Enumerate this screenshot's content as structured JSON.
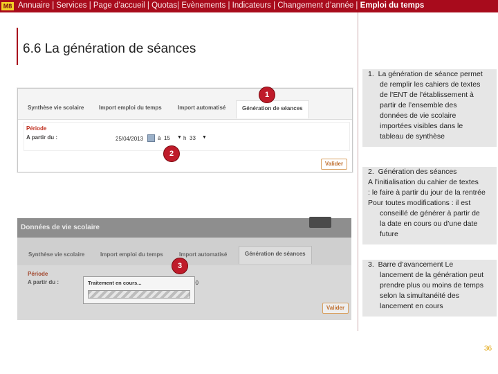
{
  "header": {
    "logo": "M8",
    "nav": "Annuaire |  Services | Page d’accueil | Quotas| Evènements | Indicateurs |  Changement d’année  |",
    "nav_current": " Emploi du temps"
  },
  "section_title": "6.6  La génération de séances",
  "screenshot_top": {
    "tabs": [
      "Synthèse vie scolaire",
      "Import emploi du temps",
      "Import automatisé",
      "Génération de séances"
    ],
    "period_title": "Période",
    "from_label": "A partir du :",
    "date_value": "25/04/2013",
    "hour_prefix": "à",
    "hour_value": "15",
    "minute_prefix": "h",
    "minute_value": "33",
    "validate_label": "Valider"
  },
  "screenshot_bottom": {
    "header_title": "Données de vie scolaire",
    "tabs": [
      "Synthèse vie scolaire",
      "Import emploi du temps",
      "Import automatisé",
      "Génération de séances"
    ],
    "period_title": "Période",
    "from_label": "A partir du :",
    "progress_title": "Traitement en cours...",
    "minute_value": "00",
    "validate_label": "Valider"
  },
  "badges": [
    "1",
    "2",
    "3"
  ],
  "notes": [
    {
      "number": "1.",
      "lines": [
        "La  génération de séance permet",
        "de remplir les cahiers de textes",
        "de l’ENT de l’établissement à",
        "partir de l’ensemble des",
        "données de vie scolaire",
        "importées visibles dans le",
        "tableau de synthèse"
      ]
    },
    {
      "number": "2.",
      "lines": [
        "Génération des séances",
        "A l’initialisation du cahier de textes",
        ": le faire à partir du jour de la rentrée",
        "Pour toutes modifications : il est",
        "conseillé de générer à partir de",
        "la date en cours ou d’une date",
        "future"
      ]
    },
    {
      "number": "3.",
      "lines": [
        "Barre d’avancement Le",
        "lancement de la génération peut",
        "prendre plus ou moins de temps",
        "selon la simultanéité des",
        "lancement en cours"
      ]
    }
  ],
  "page_number": "36",
  "colors": {
    "brand": "#a80b1c",
    "badge": "#bf1b2a",
    "note_bg": "#e6e6e6"
  }
}
